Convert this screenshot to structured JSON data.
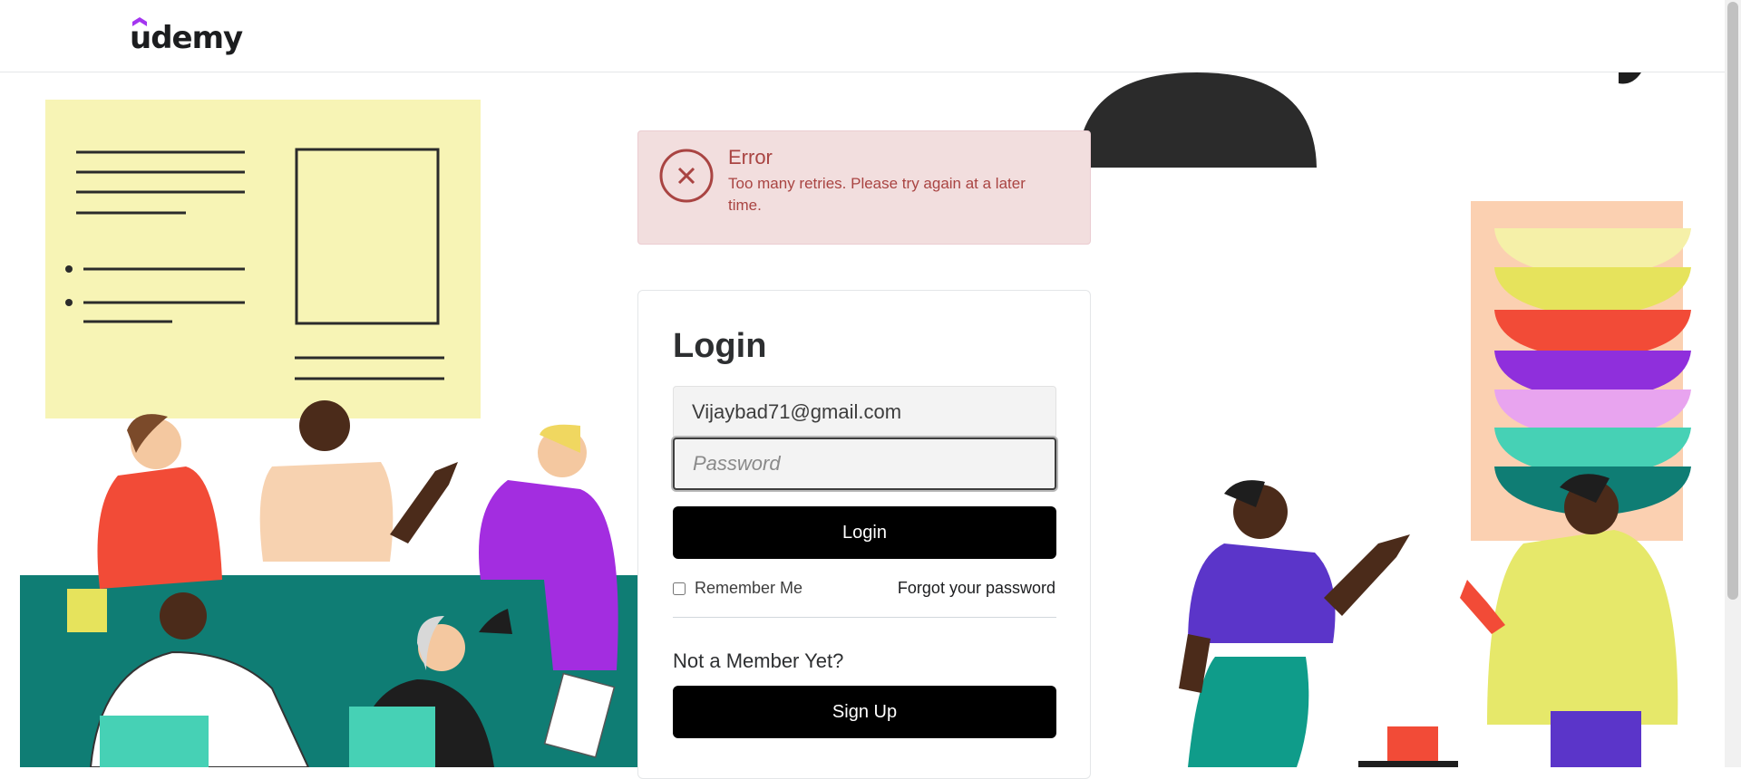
{
  "header": {
    "logo_text": "udemy",
    "logo_icon": "udemy-hat-icon"
  },
  "error": {
    "icon": "close-circle-icon",
    "title": "Error",
    "message": "Too many retries. Please try again at a later time."
  },
  "login": {
    "title": "Login",
    "email_value": "Vijaybad71@gmail.com",
    "password_placeholder": "Password",
    "login_button": "Login",
    "remember_label": "Remember Me",
    "remember_checked": false,
    "forgot_link": "Forgot your password",
    "not_member": "Not a Member Yet?",
    "signup_button": "Sign Up"
  },
  "colors": {
    "error_bg": "#f2dede",
    "error_text": "#a94442",
    "button_bg": "#000000",
    "brand_purple": "#a435f0"
  }
}
